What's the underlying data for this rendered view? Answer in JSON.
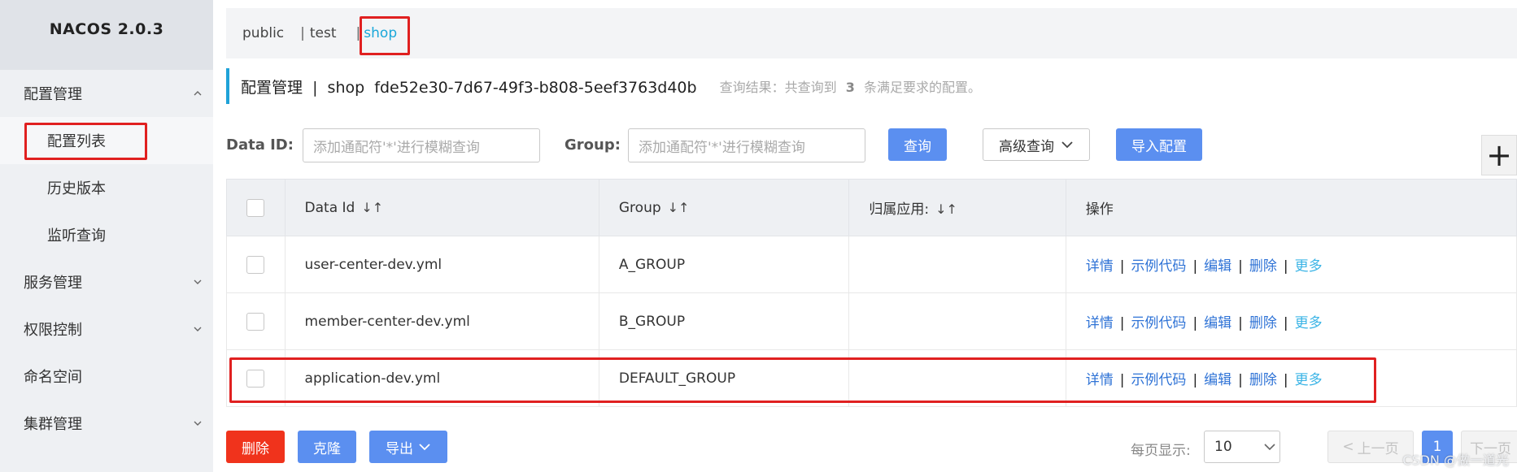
{
  "app": {
    "title": "NACOS 2.0.3"
  },
  "sidebar": {
    "groups": [
      {
        "label": "配置管理",
        "expanded": true,
        "items": [
          "配置列表",
          "历史版本",
          "监听查询"
        ]
      },
      {
        "label": "服务管理",
        "expanded": false
      },
      {
        "label": "权限控制",
        "expanded": false
      },
      {
        "label": "命名空间"
      },
      {
        "label": "集群管理",
        "expanded": false
      }
    ],
    "active_item": "配置列表"
  },
  "namespaces": {
    "items": [
      "public",
      "test",
      "shop"
    ],
    "separator": "|",
    "active": "shop"
  },
  "title": {
    "main": "配置管理  |  shop  fde52e30-7d67-49f3-b808-5eef3763d40b",
    "result_prefix": "查询结果：共查询到",
    "result_count": "3",
    "result_suffix": "条满足要求的配置。"
  },
  "search": {
    "dataid_label": "Data ID:",
    "dataid_placeholder": "添加通配符'*'进行模糊查询",
    "group_label": "Group:",
    "group_placeholder": "添加通配符'*'进行模糊查询",
    "query_btn": "查询",
    "advanced_btn": "高级查询",
    "import_btn": "导入配置",
    "add_btn": "+"
  },
  "table": {
    "columns": [
      "Data Id",
      "Group",
      "归属应用:",
      "操作"
    ],
    "sort_icon": "↓↑",
    "rows": [
      {
        "data_id": "user-center-dev.yml",
        "group": "A_GROUP",
        "app": ""
      },
      {
        "data_id": "member-center-dev.yml",
        "group": "B_GROUP",
        "app": ""
      },
      {
        "data_id": "application-dev.yml",
        "group": "DEFAULT_GROUP",
        "app": ""
      }
    ],
    "ops": [
      "详情",
      "示例代码",
      "编辑",
      "删除",
      "更多"
    ]
  },
  "footer": {
    "delete_btn": "删除",
    "clone_btn": "克隆",
    "export_btn": "导出",
    "page_size_label": "每页显示:",
    "page_size": "10",
    "prev_btn": "上一页",
    "current_page": "1",
    "next_btn": "下一页"
  },
  "watermark": "CSDN @做一道光",
  "colors": {
    "accent": "#1fa2d8",
    "primary_button": "#5b8ff0",
    "danger_button": "#f0331c",
    "link": "#2f73d6",
    "highlight_box": "#e02020"
  }
}
